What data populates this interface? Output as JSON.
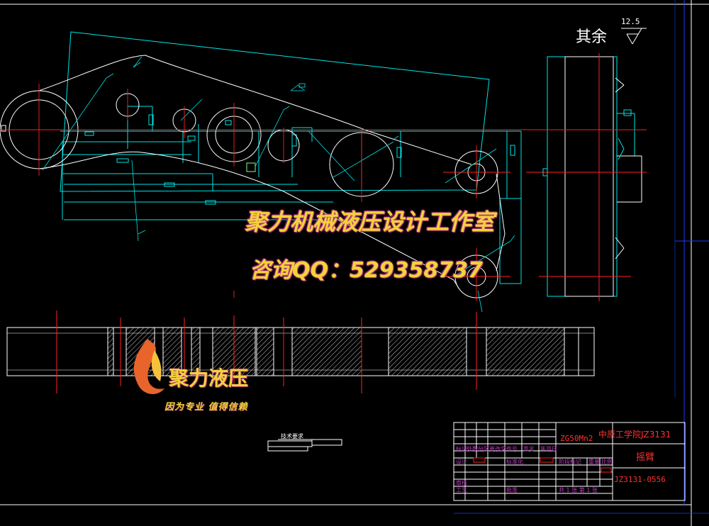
{
  "drawing": {
    "roughness_label": "其余",
    "roughness_value": "12.5"
  },
  "watermark": {
    "line1": "聚力机械液压设计工作室",
    "line2": "咨询QQ：529358737"
  },
  "logo": {
    "text": "聚力液压",
    "slogan": "因为专业 值得信赖"
  },
  "notes": {
    "technical_requirements": "技术要求"
  },
  "title_block": {
    "material": "ZG50Mn2",
    "school": "中原工学院JZ3131",
    "part_name": "摇臂",
    "drawing_code": "JZ3131-0556",
    "row_labels": [
      "标记",
      "处数",
      "分区",
      "更改文件号",
      "签名",
      "年月日"
    ],
    "design_label": "设计",
    "standardize_label": "标准化",
    "stage_label": "阶段标记",
    "weight_label": "重量",
    "scale_label": "比例",
    "review_label": "审核",
    "process_label": "工艺",
    "approve_label": "批准",
    "sheets_label": "共 1 张 第 1 张"
  },
  "colors": {
    "background": "#000000",
    "outline": "#ffffff",
    "cyan": "#00e5e5",
    "centerline": "#ff2020",
    "frame": "#1a3cff",
    "annotation": "#c038c0"
  }
}
